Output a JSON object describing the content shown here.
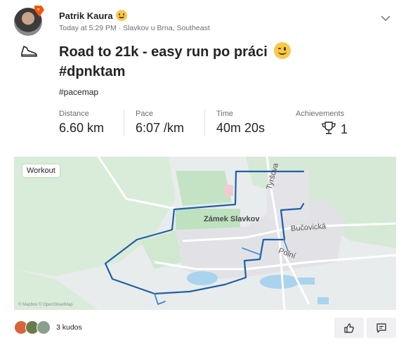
{
  "athlete": {
    "name": "Patrik Kaura",
    "emoji": "yum-emoji",
    "meta": "Today at 5:29 PM · Slavkov u Brna, Southeast"
  },
  "activity": {
    "sport_icon": "shoe-icon",
    "title": "Road to 21k - easy run po práci",
    "title_tag": "#dpnktam",
    "title_emoji": "wink-emoji",
    "description": "#pacemap"
  },
  "stats": [
    {
      "label": "Distance",
      "value": "6.60 km"
    },
    {
      "label": "Pace",
      "value": "6:07 /km"
    },
    {
      "label": "Time",
      "value": "40m 20s"
    },
    {
      "label": "Achievements",
      "value": "1",
      "icon": "trophy-icon"
    }
  ],
  "map": {
    "tag": "Workout",
    "labels": {
      "castle": "Zámek Slavkov",
      "street1": "Tyršova",
      "street2": "Bučovická",
      "street3": "Polní"
    },
    "attribution": "© Mapbox © OpenStreetMap",
    "route_color": "#1f5fa8"
  },
  "kudos": {
    "count_text": "3 kudos"
  },
  "actions": {
    "kudos_icon": "thumbs-up-icon",
    "comment_icon": "comment-icon"
  },
  "colors": {
    "brand": "#fc5200",
    "text": "#242428",
    "muted": "#6d6d78",
    "map_green": "#c4e3c5",
    "map_water": "#a9d3ee"
  }
}
